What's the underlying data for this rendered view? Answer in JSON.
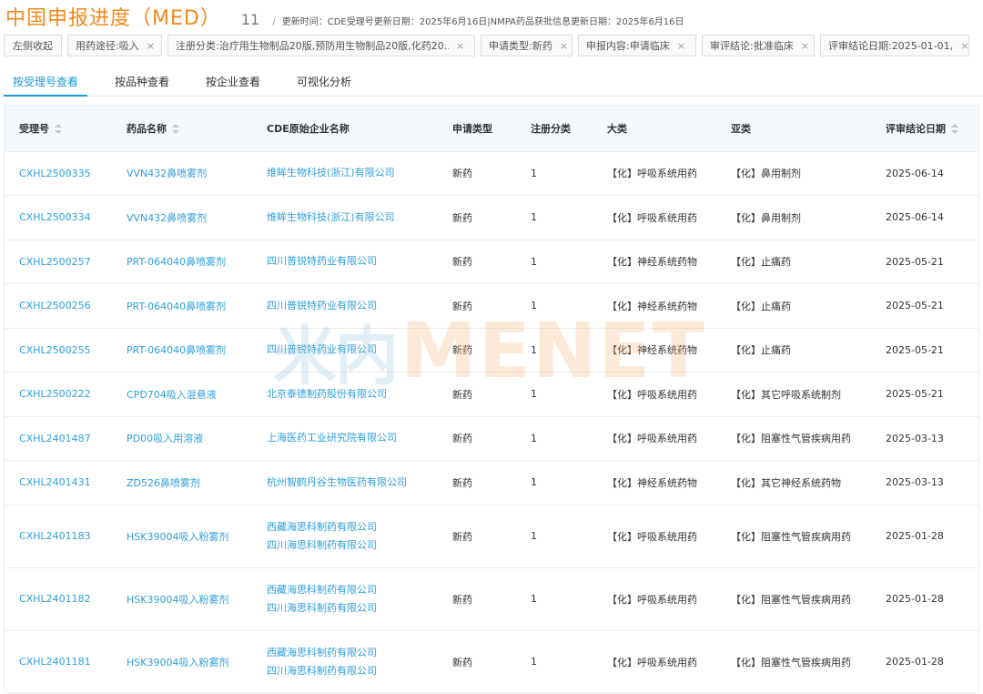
{
  "header": {
    "title": "中国申报进度（MED）",
    "count": "11",
    "separator": "/",
    "update_text": "更新时间：CDE受理号更新日期：2025年6月16日|NMPA药品获批信息更新日期：2025年6月16日"
  },
  "filters": {
    "collapse_label": "左侧收起",
    "close_glyph": "×",
    "chips": [
      {
        "label": "用药途径:吸入"
      },
      {
        "label": "注册分类:治疗用生物制品20版,预防用生物制品20版,化药20..."
      },
      {
        "label": "申请类型:新药"
      },
      {
        "label": "申报内容:申请临床"
      },
      {
        "label": "审评结论:批准临床"
      },
      {
        "label": "评审结论日期:2025-01-01,"
      }
    ]
  },
  "tabs": [
    {
      "label": "按受理号查看",
      "active": true
    },
    {
      "label": "按品种查看",
      "active": false
    },
    {
      "label": "按企业查看",
      "active": false
    },
    {
      "label": "可视化分析",
      "active": false
    }
  ],
  "table": {
    "columns": [
      "受理号",
      "药品名称",
      "CDE原始企业名称",
      "申请类型",
      "注册分类",
      "大类",
      "亚类",
      "评审结论日期"
    ],
    "rows": [
      {
        "id": "CXHL2500335",
        "drug": "VVN432鼻喷雾剂",
        "companies": [
          "维眸生物科技(浙江)有限公司"
        ],
        "type": "新药",
        "class": "1",
        "category": "【化】呼吸系统用药",
        "subcategory": "【化】鼻用制剂",
        "date": "2025-06-14"
      },
      {
        "id": "CXHL2500334",
        "drug": "VVN432鼻喷雾剂",
        "companies": [
          "维眸生物科技(浙江)有限公司"
        ],
        "type": "新药",
        "class": "1",
        "category": "【化】呼吸系统用药",
        "subcategory": "【化】鼻用制剂",
        "date": "2025-06-14"
      },
      {
        "id": "CXHL2500257",
        "drug": "PRT-064040鼻喷雾剂",
        "companies": [
          "四川普锐特药业有限公司"
        ],
        "type": "新药",
        "class": "1",
        "category": "【化】神经系统药物",
        "subcategory": "【化】止痛药",
        "date": "2025-05-21"
      },
      {
        "id": "CXHL2500256",
        "drug": "PRT-064040鼻喷雾剂",
        "companies": [
          "四川普锐特药业有限公司"
        ],
        "type": "新药",
        "class": "1",
        "category": "【化】神经系统药物",
        "subcategory": "【化】止痛药",
        "date": "2025-05-21"
      },
      {
        "id": "CXHL2500255",
        "drug": "PRT-064040鼻喷雾剂",
        "companies": [
          "四川普锐特药业有限公司"
        ],
        "type": "新药",
        "class": "1",
        "category": "【化】神经系统药物",
        "subcategory": "【化】止痛药",
        "date": "2025-05-21"
      },
      {
        "id": "CXHL2500222",
        "drug": "CPD704吸入混悬液",
        "companies": [
          "北京泰德制药股份有限公司"
        ],
        "type": "新药",
        "class": "1",
        "category": "【化】呼吸系统用药",
        "subcategory": "【化】其它呼吸系统制剂",
        "date": "2025-05-21"
      },
      {
        "id": "CXHL2401487",
        "drug": "PD00吸入用溶液",
        "companies": [
          "上海医药工业研究院有限公司"
        ],
        "type": "新药",
        "class": "1",
        "category": "【化】呼吸系统用药",
        "subcategory": "【化】阻塞性气管疾病用药",
        "date": "2025-03-13"
      },
      {
        "id": "CXHL2401431",
        "drug": "ZD526鼻喷雾剂",
        "companies": [
          "杭州智鹤丹谷生物医药有限公司"
        ],
        "type": "新药",
        "class": "1",
        "category": "【化】神经系统药物",
        "subcategory": "【化】其它神经系统药物",
        "date": "2025-03-13"
      },
      {
        "id": "CXHL2401183",
        "drug": "HSK39004吸入粉雾剂",
        "companies": [
          "西藏海思科制药有限公司",
          "四川海思科制药有限公司"
        ],
        "type": "新药",
        "class": "1",
        "category": "【化】呼吸系统用药",
        "subcategory": "【化】阻塞性气管疾病用药",
        "date": "2025-01-28"
      },
      {
        "id": "CXHL2401182",
        "drug": "HSK39004吸入粉雾剂",
        "companies": [
          "西藏海思科制药有限公司",
          "四川海思科制药有限公司"
        ],
        "type": "新药",
        "class": "1",
        "category": "【化】呼吸系统用药",
        "subcategory": "【化】阻塞性气管疾病用药",
        "date": "2025-01-28"
      },
      {
        "id": "CXHL2401181",
        "drug": "HSK39004吸入粉雾剂",
        "companies": [
          "西藏海思科制药有限公司",
          "四川海思科制药有限公司"
        ],
        "type": "新药",
        "class": "1",
        "category": "【化】呼吸系统用药",
        "subcategory": "【化】阻塞性气管疾病用药",
        "date": "2025-01-28"
      }
    ]
  },
  "watermark": {
    "cn": "米内",
    "en": "MENET"
  },
  "colors": {
    "title": "#f08a1c",
    "link": "#2f9fd8",
    "tab_active": "#1a9ad6",
    "header_bg": "#f4f9fc"
  }
}
